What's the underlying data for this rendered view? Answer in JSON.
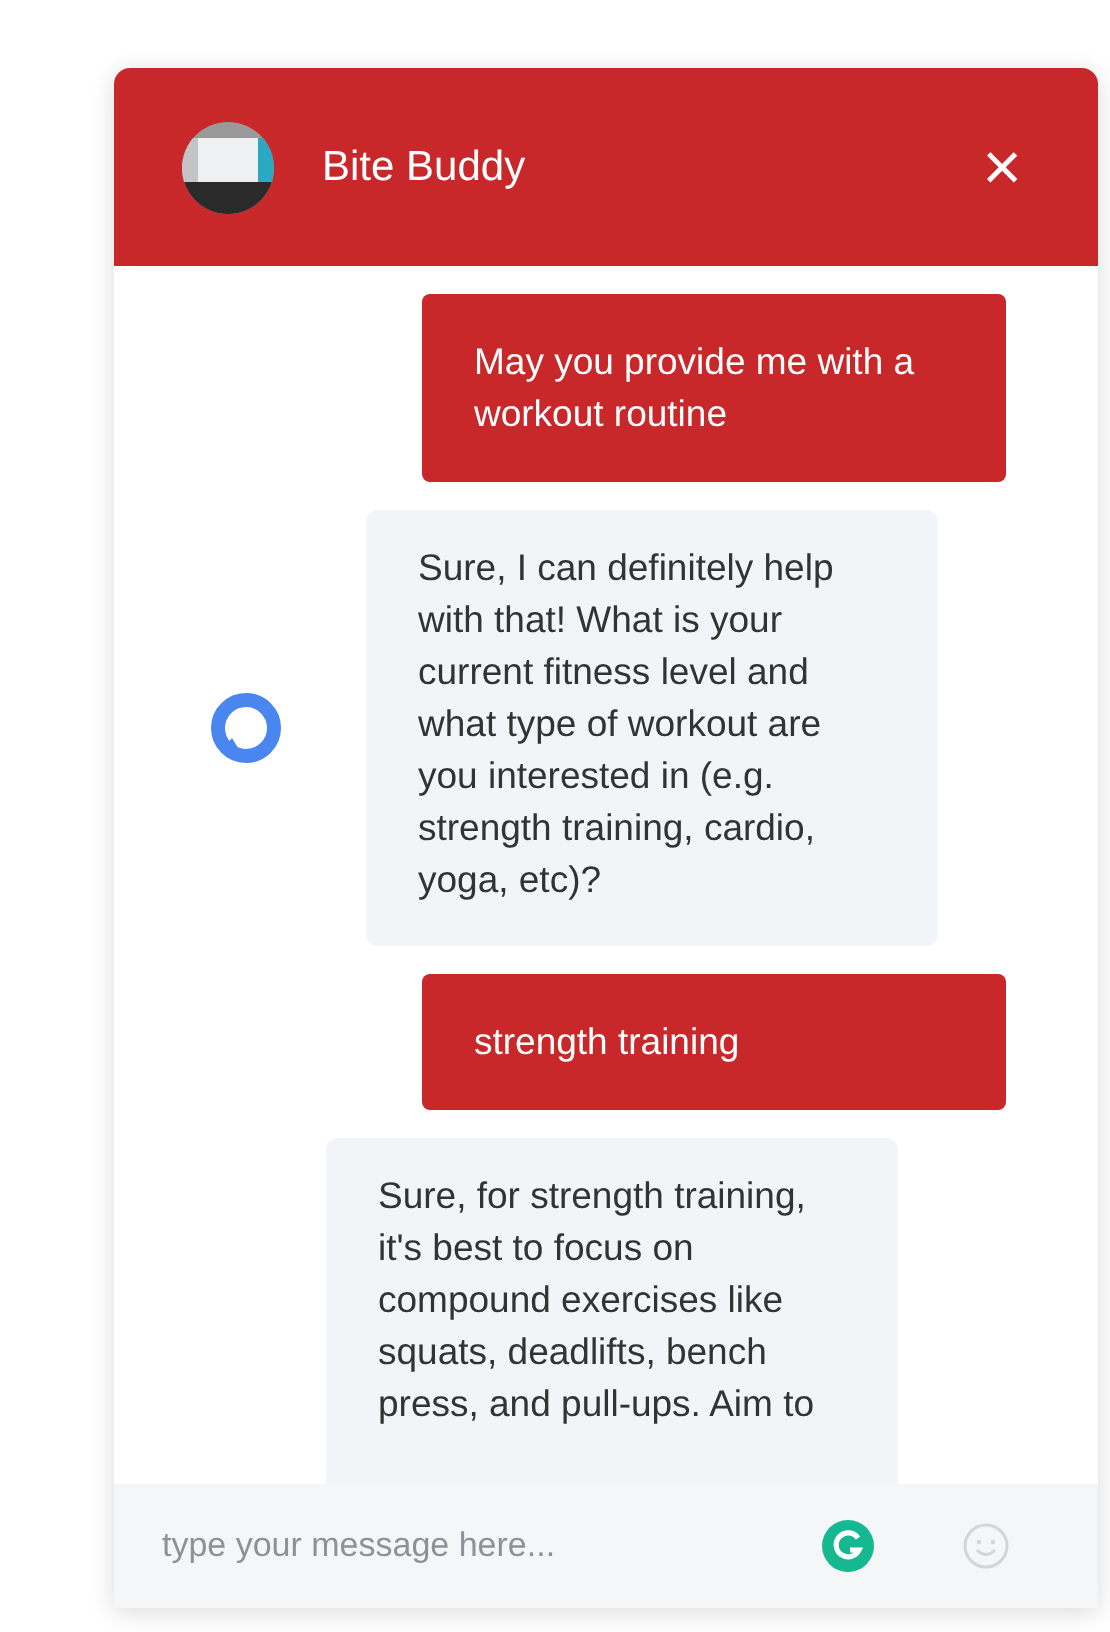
{
  "header": {
    "title": "Bite Buddy",
    "close": "×"
  },
  "messages": [
    {
      "kind": "user",
      "text": "May you provide me with a workout routine"
    },
    {
      "kind": "bot",
      "avatar": true,
      "text": "Sure, I can definitely help with that! What is your current fitness level and what type of workout are you interested in (e.g. strength training, cardio, yoga, etc)?"
    },
    {
      "kind": "user",
      "text": "strength training"
    },
    {
      "kind": "bot",
      "avatar": false,
      "text": "Sure, for strength training, it's best to focus on compound exercises like squats, deadlifts, bench press, and pull-ups. Aim to"
    }
  ],
  "composer": {
    "placeholder": "type your message here..."
  }
}
